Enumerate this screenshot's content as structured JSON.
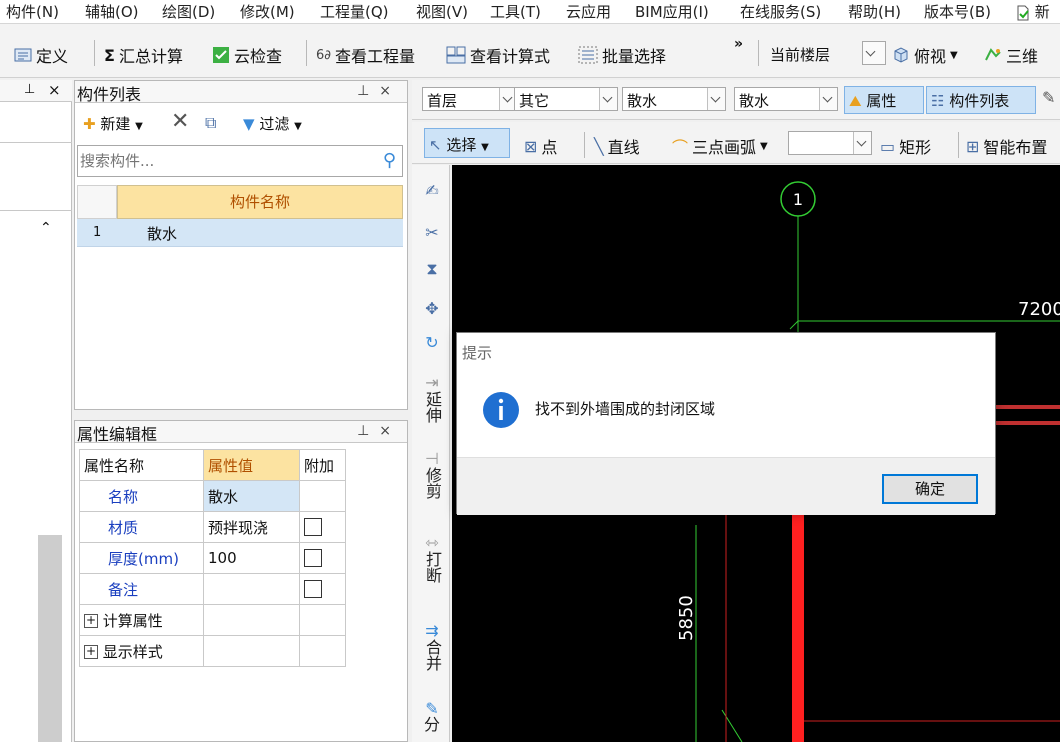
{
  "menu": [
    "构件(N)",
    "辅轴(O)",
    "绘图(D)",
    "修改(M)",
    "工程量(Q)",
    "视图(V)",
    "工具(T)",
    "云应用",
    "BIM应用(I)",
    "在线服务(S)",
    "帮助(H)",
    "版本号(B)",
    "新"
  ],
  "toolbar1": {
    "define": "定义",
    "sum_calc": "汇总计算",
    "cloud_check": "云检查",
    "view_quantity": "查看工程量",
    "view_formula": "查看计算式",
    "batch_select": "批量选择",
    "more": "»",
    "floor_label": "当前楼层",
    "top_view": "俯视",
    "three_d": "三维"
  },
  "toolbar2": {
    "floor": "首层",
    "category": "其它",
    "type": "散水",
    "component": "散水",
    "attr": "属性",
    "comp_list": "构件列表"
  },
  "toolbar3": {
    "select": "选择",
    "point": "点",
    "line": "直线",
    "arc": "三点画弧",
    "rect": "矩形",
    "smart": "智能布置"
  },
  "complist": {
    "title": "构件列表",
    "new": "新建",
    "filter": "过滤",
    "search_placeholder": "搜索构件...",
    "col_name": "构件名称",
    "rows": [
      {
        "index": "1",
        "name": "散水"
      }
    ]
  },
  "propeditor": {
    "title": "属性编辑框",
    "headers": [
      "属性名称",
      "属性值",
      "附加"
    ],
    "rows": [
      {
        "name": "名称",
        "value": "散水"
      },
      {
        "name": "材质",
        "value": "预拌现浇"
      },
      {
        "name": "厚度(mm)",
        "value": "100"
      },
      {
        "name": "备注",
        "value": ""
      }
    ],
    "groups": [
      "计算属性",
      "显示样式"
    ]
  },
  "vtools": [
    "延伸",
    "修剪",
    "打断",
    "合并",
    "分"
  ],
  "canvas": {
    "axis_label": "1",
    "dim_top": "7200",
    "dim_left": "5850"
  },
  "dialog": {
    "title": "提示",
    "message": "找不到外墙围成的封闭区域",
    "ok": "确定"
  },
  "colors": {
    "accent": "#0078d7",
    "header_bg": "#fce3a1",
    "selected_row": "#d4e6f6",
    "canvas_bg": "#000000",
    "axis_green": "#33cc33",
    "wall_red": "#ff2020"
  }
}
